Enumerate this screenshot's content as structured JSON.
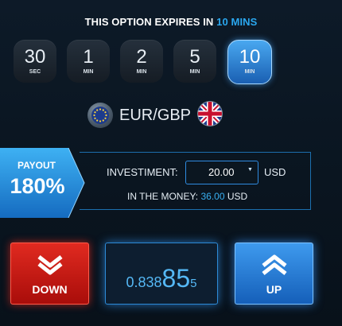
{
  "expiry": {
    "title_prefix": "THIS OPTION EXPIRES IN",
    "title_value": "10 MINS",
    "options": [
      {
        "value": "30",
        "unit": "SEC",
        "selected": false
      },
      {
        "value": "1",
        "unit": "MIN",
        "selected": false
      },
      {
        "value": "2",
        "unit": "MIN",
        "selected": false
      },
      {
        "value": "5",
        "unit": "MIN",
        "selected": false
      },
      {
        "value": "10",
        "unit": "MIN",
        "selected": true
      }
    ]
  },
  "asset": {
    "pair": "EUR/GBP",
    "base_flag_icon": "eu-flag-icon",
    "quote_flag_icon": "uk-flag-icon"
  },
  "payout": {
    "label": "PAYOUT",
    "value": "180%"
  },
  "investment": {
    "label": "INVESTIMENT:",
    "amount": "20.00",
    "currency": "USD",
    "in_the_money_label": "IN THE MONEY:",
    "in_the_money_amount": "36.00",
    "in_the_money_currency": "USD"
  },
  "price": {
    "prefix": "0.838",
    "big_digits": "85",
    "suffix": "5"
  },
  "actions": {
    "down_label": "DOWN",
    "up_label": "UP",
    "down_icon": "double-chevron-down-icon",
    "up_icon": "chevron-up-icon"
  },
  "colors": {
    "accent": "#2aa7ef",
    "down": "#d81c14",
    "up": "#2f86e0",
    "background": "#0d1a28"
  }
}
